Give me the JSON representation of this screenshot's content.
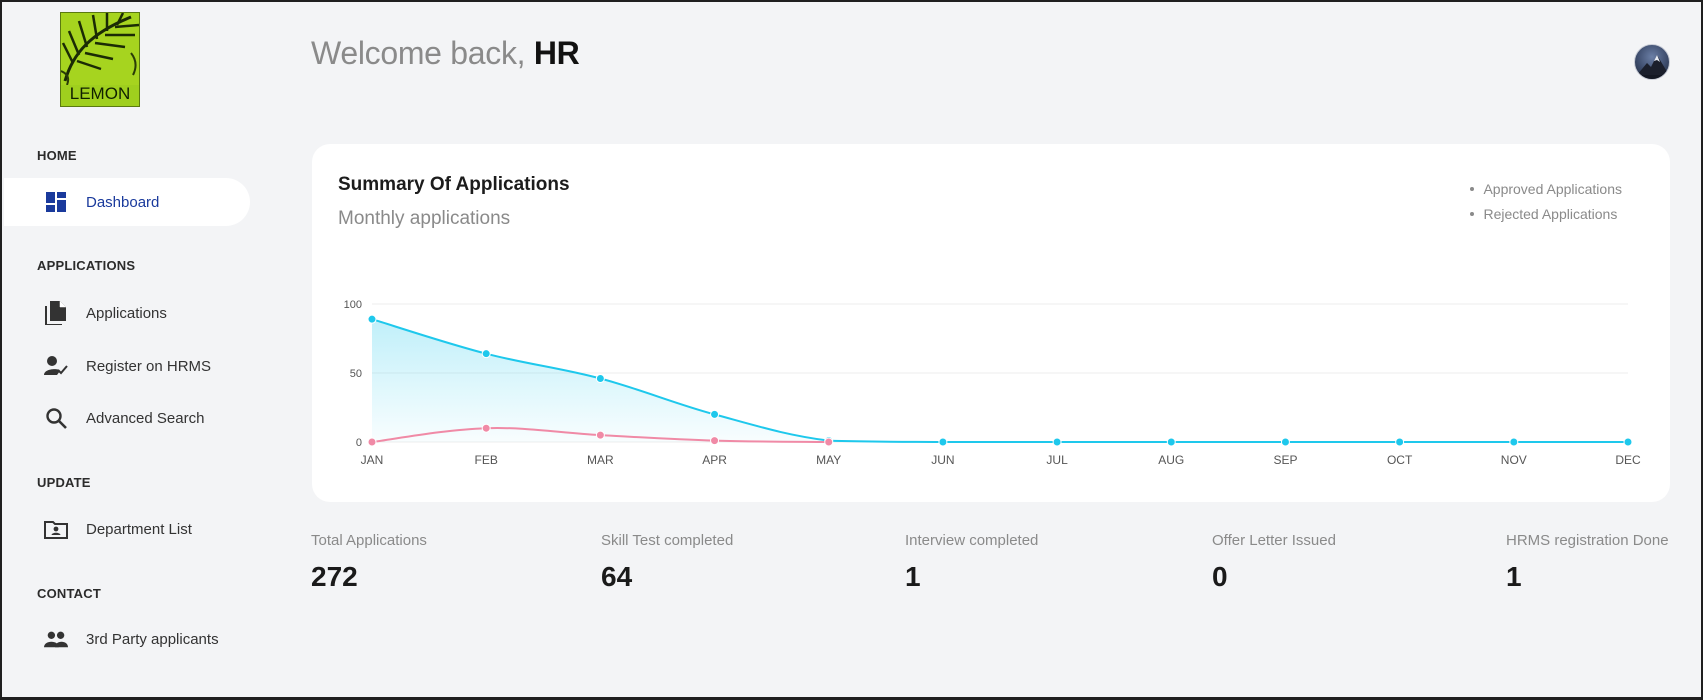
{
  "sidebar": {
    "logo_text": "LEMON",
    "sections": {
      "home": "HOME",
      "applications": "APPLICATIONS",
      "update": "UPDATE",
      "contact": "CONTACT"
    },
    "items": {
      "dashboard": "Dashboard",
      "applications": "Applications",
      "register": "Register on HRMS",
      "search": "Advanced Search",
      "departments": "Department List",
      "third_party": "3rd Party applicants"
    }
  },
  "header": {
    "welcome_prefix": "Welcome back, ",
    "user": "HR"
  },
  "colors": {
    "approved": "#1ec8ec",
    "rejected": "#f08aa6",
    "accent": "#1a3a9c"
  },
  "chart_data": {
    "type": "area",
    "title": "Summary Of Applications",
    "subtitle": "Monthly applications",
    "legend_position": "top-right",
    "categories": [
      "JAN",
      "FEB",
      "MAR",
      "APR",
      "MAY",
      "JUN",
      "JUL",
      "AUG",
      "SEP",
      "OCT",
      "NOV",
      "DEC"
    ],
    "yticks": [
      0,
      50,
      100
    ],
    "ylim": [
      0,
      100
    ],
    "grid": true,
    "series": [
      {
        "name": "Approved Applications",
        "values": [
          89,
          64,
          46,
          20,
          1,
          0,
          0,
          0,
          0,
          0,
          0,
          0
        ]
      },
      {
        "name": "Rejected Applications",
        "values": [
          0,
          10,
          5,
          1,
          0,
          null,
          null,
          null,
          null,
          null,
          null,
          null
        ]
      }
    ]
  },
  "stats": [
    {
      "label": "Total Applications",
      "value": "272"
    },
    {
      "label": "Skill Test completed",
      "value": "64"
    },
    {
      "label": "Interview completed",
      "value": "1"
    },
    {
      "label": "Offer Letter Issued",
      "value": "0"
    },
    {
      "label": "HRMS registration Done",
      "value": "1"
    }
  ]
}
